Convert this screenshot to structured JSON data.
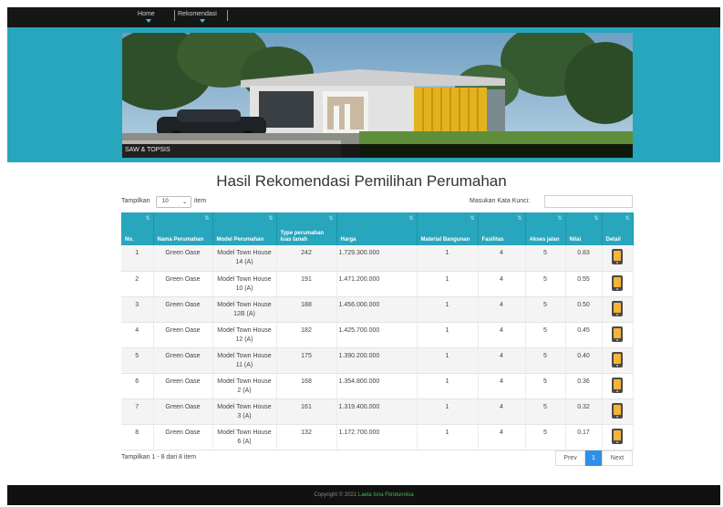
{
  "nav": {
    "home": "Home",
    "rekomendasi": "Rekomendasi"
  },
  "banner": {
    "caption": "SAW & TOPSIS"
  },
  "page_title": "Hasil Rekomendasi Pemilihan Perumahan",
  "controls": {
    "show_label": "Tampilkan",
    "page_length": "10",
    "item_label": "item",
    "search_label": "Masukan Kata Kunci:",
    "search_value": ""
  },
  "table": {
    "headers": [
      "No.",
      "Nama Perumahan",
      "Model Perumahan",
      "Type perumahan luas tanah",
      "Harga",
      "Material Bangunan",
      "Fasilitas",
      "Akses jalan",
      "Nilai",
      "Detail"
    ],
    "rows": [
      {
        "no": "1",
        "nama": "Green Oase",
        "model": "Model Town House 14 (A)",
        "type": "242",
        "harga": "1.729.300.000",
        "material": "1",
        "fasilitas": "4",
        "akses": "5",
        "nilai": "0.83"
      },
      {
        "no": "2",
        "nama": "Green Oase",
        "model": "Model Town House 10 (A)",
        "type": "191",
        "harga": "1.471.200.000",
        "material": "1",
        "fasilitas": "4",
        "akses": "5",
        "nilai": "0.55"
      },
      {
        "no": "3",
        "nama": "Green Oase",
        "model": "Model Town House 12B (A)",
        "type": "188",
        "harga": "1.456.000.000",
        "material": "1",
        "fasilitas": "4",
        "akses": "5",
        "nilai": "0.50"
      },
      {
        "no": "4",
        "nama": "Green Oase",
        "model": "Model Town House 12 (A)",
        "type": "182",
        "harga": "1.425.700.000",
        "material": "1",
        "fasilitas": "4",
        "akses": "5",
        "nilai": "0.45"
      },
      {
        "no": "5",
        "nama": "Green Oase",
        "model": "Model Town House 11 (A)",
        "type": "175",
        "harga": "1.390.200.000",
        "material": "1",
        "fasilitas": "4",
        "akses": "5",
        "nilai": "0.40"
      },
      {
        "no": "6",
        "nama": "Green Oase",
        "model": "Model Town House 2 (A)",
        "type": "168",
        "harga": "1.354.800.000",
        "material": "1",
        "fasilitas": "4",
        "akses": "5",
        "nilai": "0.36"
      },
      {
        "no": "7",
        "nama": "Green Oase",
        "model": "Model Town House 3 (A)",
        "type": "161",
        "harga": "1.319.400.000",
        "material": "1",
        "fasilitas": "4",
        "akses": "5",
        "nilai": "0.32"
      },
      {
        "no": "8",
        "nama": "Green Oase",
        "model": "Model Town House 6 (A)",
        "type": "132",
        "harga": "1.172.700.000",
        "material": "1",
        "fasilitas": "4",
        "akses": "5",
        "nilai": "0.17"
      }
    ]
  },
  "footer_info": "Tampilkan 1 - 8 dari 8 item",
  "pagination": {
    "prev": "Prev",
    "current": "1",
    "next": "Next"
  },
  "footer": {
    "copyright": "Copyright © 2021",
    "author": "Laela Isna Fitrotunnisa"
  },
  "colors": {
    "accent": "#27a6bd",
    "nav_bg": "#161616",
    "page_active": "#2e8fe6",
    "footer_author": "#3fbf4f",
    "detail_icon": "#f4b43a"
  },
  "icons": {
    "detail": "phone-detail-icon",
    "sort": "sort-icon",
    "dropdown": "chevron-down-icon"
  }
}
